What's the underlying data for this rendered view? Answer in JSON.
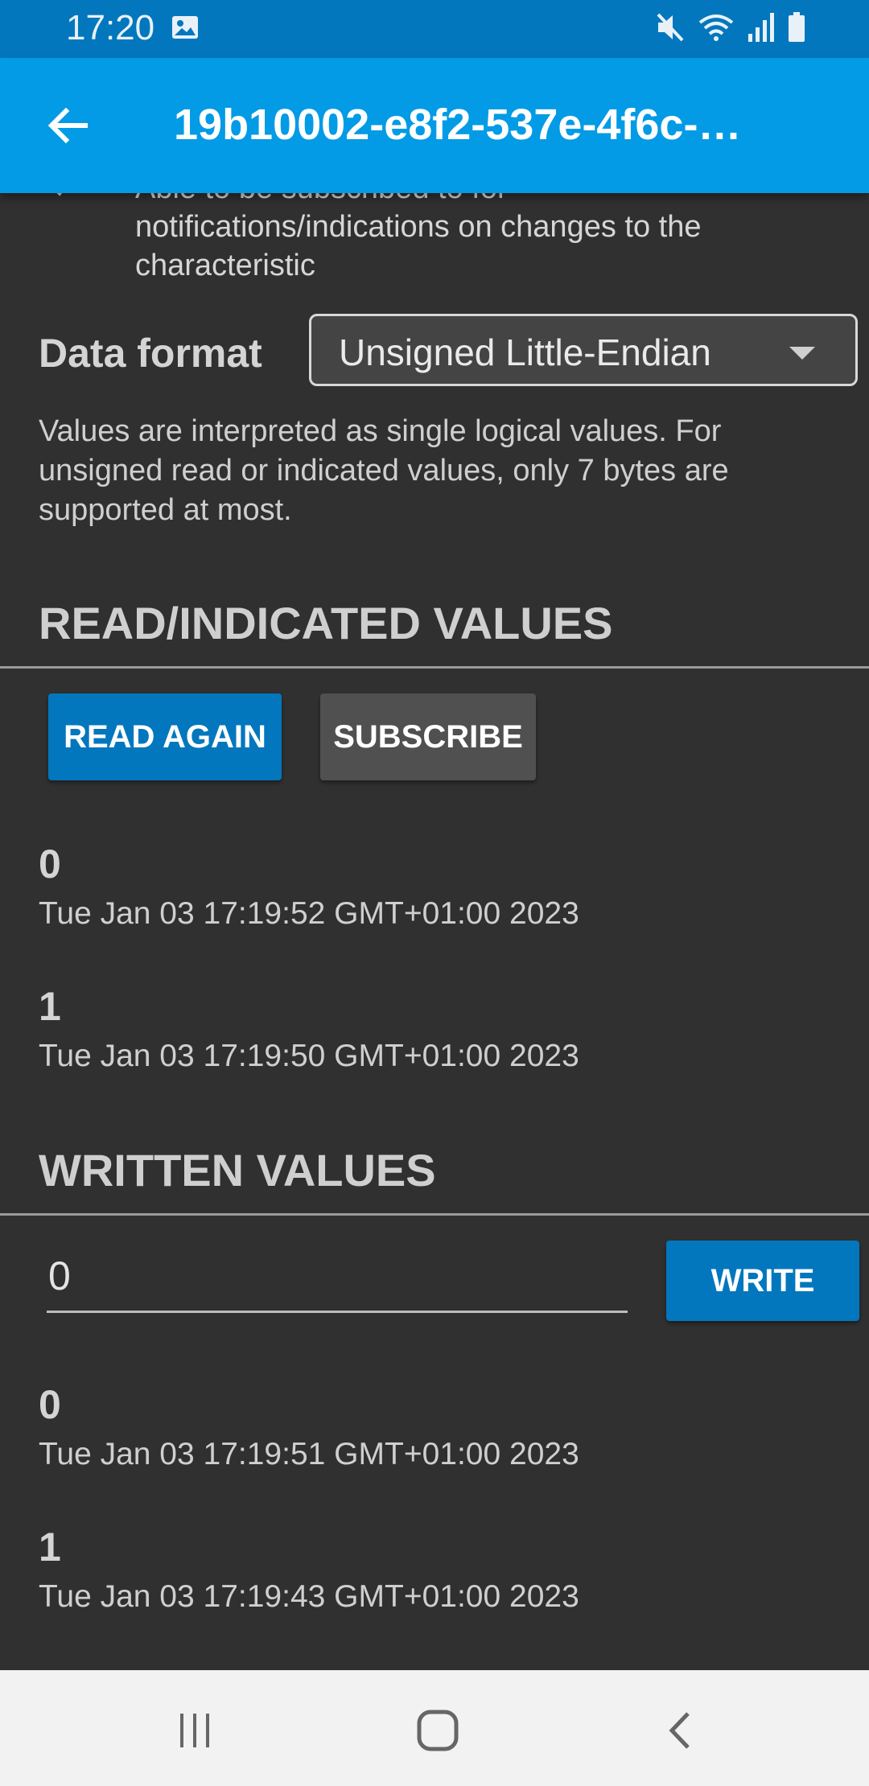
{
  "status_bar": {
    "time": "17:20",
    "icons": [
      "gallery-icon",
      "mute-icon",
      "wifi-icon",
      "signal-icon",
      "battery-icon"
    ]
  },
  "app_bar": {
    "title": "19b10002-e8f2-537e-4f6c-…",
    "back_icon": "arrow-back-icon",
    "color": "#039be5"
  },
  "properties": {
    "last_item_text": "Able to be subscribed to for notifications/indications on changes to the characteristic"
  },
  "data_format": {
    "label": "Data format",
    "selected": "Unsigned Little-Endian",
    "description": "Values are interpreted as single logical values. For unsigned read or indicated values, only 7 bytes are supported at most."
  },
  "read_section": {
    "title": "READ/INDICATED VALUES",
    "read_again_label": "READ AGAIN",
    "subscribe_label": "SUBSCRIBE",
    "entries": [
      {
        "value": "0",
        "time": "Tue Jan 03 17:19:52 GMT+01:00 2023"
      },
      {
        "value": "1",
        "time": "Tue Jan 03 17:19:50 GMT+01:00 2023"
      }
    ]
  },
  "write_section": {
    "title": "WRITTEN VALUES",
    "input_value": "0",
    "write_label": "WRITE",
    "entries": [
      {
        "value": "0",
        "time": "Tue Jan 03 17:19:51 GMT+01:00 2023"
      },
      {
        "value": "1",
        "time": "Tue Jan 03 17:19:43 GMT+01:00 2023"
      }
    ]
  },
  "nav_bar": {
    "recents_icon": "recents-icon",
    "home_icon": "home-icon",
    "back_icon": "nav-back-icon"
  },
  "colors": {
    "primary": "#0277bd",
    "background": "#303030"
  }
}
